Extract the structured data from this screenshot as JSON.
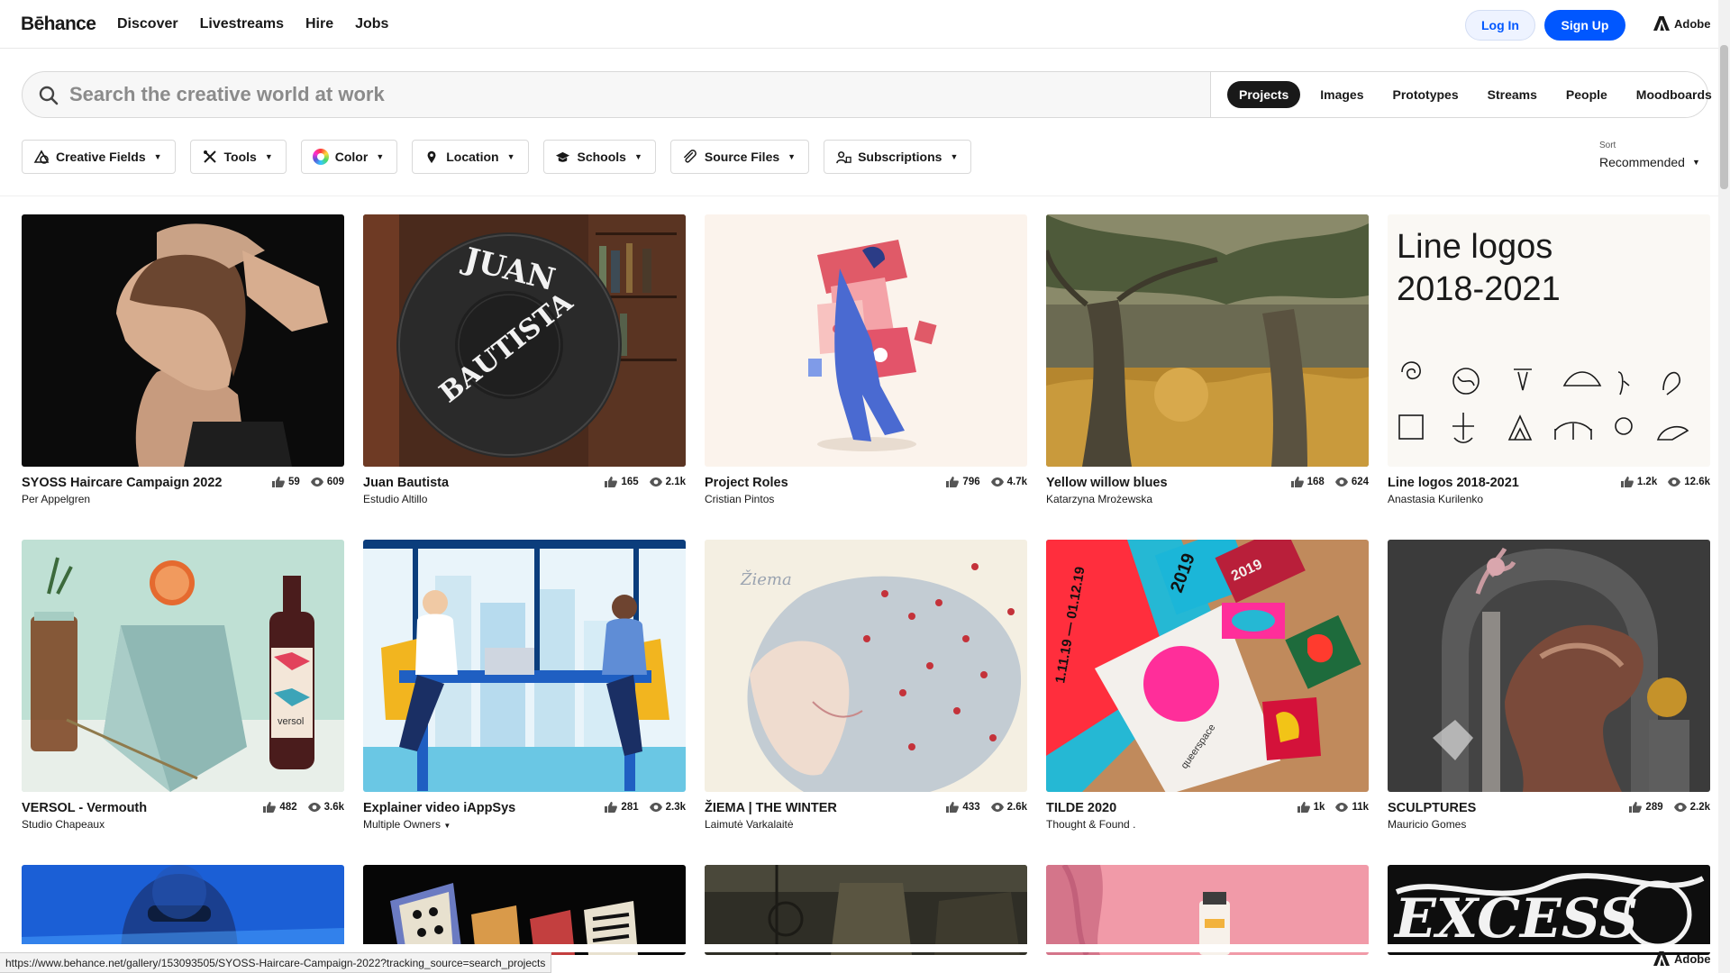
{
  "nav": {
    "logo": "Bēhance",
    "links": [
      "Discover",
      "Livestreams",
      "Hire",
      "Jobs"
    ],
    "login": "Log In",
    "signup": "Sign Up",
    "adobe": "Adobe"
  },
  "search": {
    "placeholder": "Search the creative world at work",
    "tabs": [
      "Projects",
      "Images",
      "Prototypes",
      "Streams",
      "People",
      "Moodboards"
    ],
    "active_tab": "Projects"
  },
  "filters": [
    {
      "label": "Creative Fields",
      "icon": "creative-fields-icon"
    },
    {
      "label": "Tools",
      "icon": "tools-icon"
    },
    {
      "label": "Color",
      "icon": "color-wheel-icon"
    },
    {
      "label": "Location",
      "icon": "location-pin-icon"
    },
    {
      "label": "Schools",
      "icon": "graduation-cap-icon"
    },
    {
      "label": "Source Files",
      "icon": "paperclip-icon"
    },
    {
      "label": "Subscriptions",
      "icon": "subscriptions-icon"
    }
  ],
  "sort": {
    "label": "Sort",
    "value": "Recommended"
  },
  "projects": [
    {
      "title": "SYOSS Haircare Campaign 2022",
      "owner": "Per Appelgren",
      "likes": "59",
      "views": "609"
    },
    {
      "title": "Juan Bautista",
      "owner": "Estudio Altillo",
      "likes": "165",
      "views": "2.1k"
    },
    {
      "title": "Project Roles",
      "owner": "Cristian Pintos",
      "likes": "796",
      "views": "4.7k"
    },
    {
      "title": "Yellow willow blues",
      "owner": "Katarzyna Mrożewska",
      "likes": "168",
      "views": "624"
    },
    {
      "title": "Line logos 2018-2021",
      "owner": "Anastasia Kurilenko",
      "likes": "1.2k",
      "views": "12.6k"
    },
    {
      "title": "VERSOL - Vermouth",
      "owner": "Studio Chapeaux",
      "likes": "482",
      "views": "3.6k"
    },
    {
      "title": "Explainer video iAppSys",
      "owner": "Multiple Owners",
      "likes": "281",
      "views": "2.3k"
    },
    {
      "title": "ŽIEMA | THE WINTER",
      "owner": "Laimutė Varkalaitė",
      "likes": "433",
      "views": "2.6k"
    },
    {
      "title": "TILDE 2020",
      "owner": "Thought & Found .",
      "likes": "1k",
      "views": "11k"
    },
    {
      "title": "SCULPTURES",
      "owner": "Mauricio Gomes",
      "likes": "289",
      "views": "2.2k"
    }
  ],
  "thumb_text": {
    "juan_top": "JUAN",
    "juan_side": "BAUTISTA",
    "line_logos_1": "Line logos",
    "line_logos_2": "2018-2021",
    "versol_label": "versol",
    "tilde_year": "2019",
    "tilde_dates": "1.11.19 — 01.12.19",
    "tilde_sticker": "2019",
    "tilde_brand": "queerspace",
    "ziema_sign": "Žiema",
    "excess": "EXCESS"
  },
  "status_url": "https://www.behance.net/gallery/153093505/SYOSS-Haircare-Campaign-2022?tracking_source=search_projects",
  "colors": {
    "brand_blue": "#0057ff",
    "text": "#191919",
    "border": "#d9d9d9"
  }
}
